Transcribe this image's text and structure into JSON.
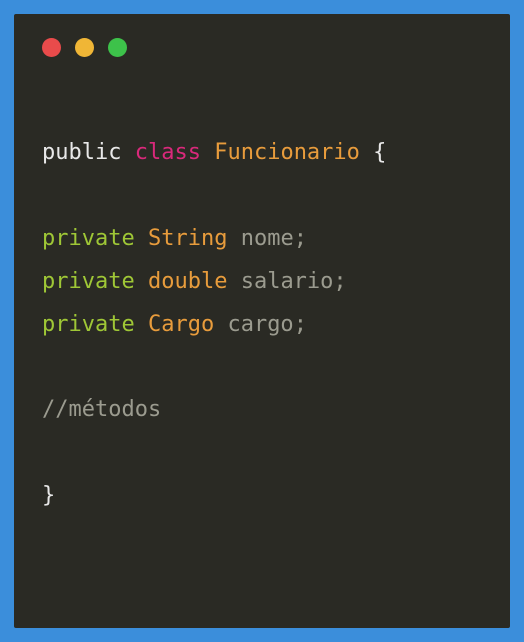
{
  "code": {
    "line1": {
      "public": "public",
      "class": "class",
      "className": "Funcionario",
      "openBrace": "{"
    },
    "fields": [
      {
        "modifier": "private",
        "type": "String",
        "name": "nome",
        "semi": ";"
      },
      {
        "modifier": "private",
        "type": "double",
        "name": "salario",
        "semi": ";"
      },
      {
        "modifier": "private",
        "type": "Cargo",
        "name": "cargo",
        "semi": ";"
      }
    ],
    "comment": "//métodos",
    "closeBrace": "}"
  }
}
